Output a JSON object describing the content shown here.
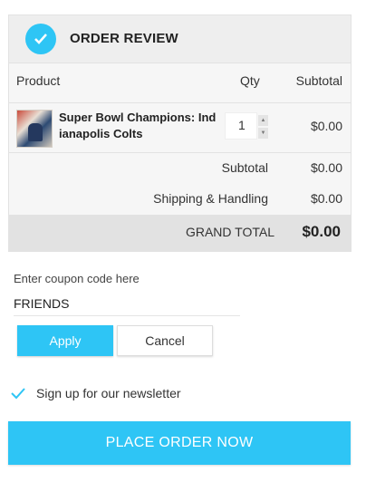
{
  "header": {
    "title": "ORDER REVIEW",
    "icon": "check-icon"
  },
  "table": {
    "columns": [
      "Product",
      "Qty",
      "Subtotal"
    ],
    "items": [
      {
        "name": "Super Bowl Champions: Indianapolis Colts",
        "qty": "1",
        "subtotal": "$0.00"
      }
    ]
  },
  "totals": {
    "subtotal_label": "Subtotal",
    "subtotal_value": "$0.00",
    "shipping_label": "Shipping & Handling",
    "shipping_value": "$0.00",
    "grand_label": "GRAND TOTAL",
    "grand_value": "$0.00"
  },
  "coupon": {
    "label": "Enter coupon code here",
    "value": "FRIENDS",
    "apply_label": "Apply",
    "cancel_label": "Cancel"
  },
  "newsletter": {
    "label": "Sign up for our newsletter",
    "checked": true
  },
  "place_order_label": "PLACE ORDER NOW",
  "colors": {
    "accent": "#2ec5f5"
  }
}
